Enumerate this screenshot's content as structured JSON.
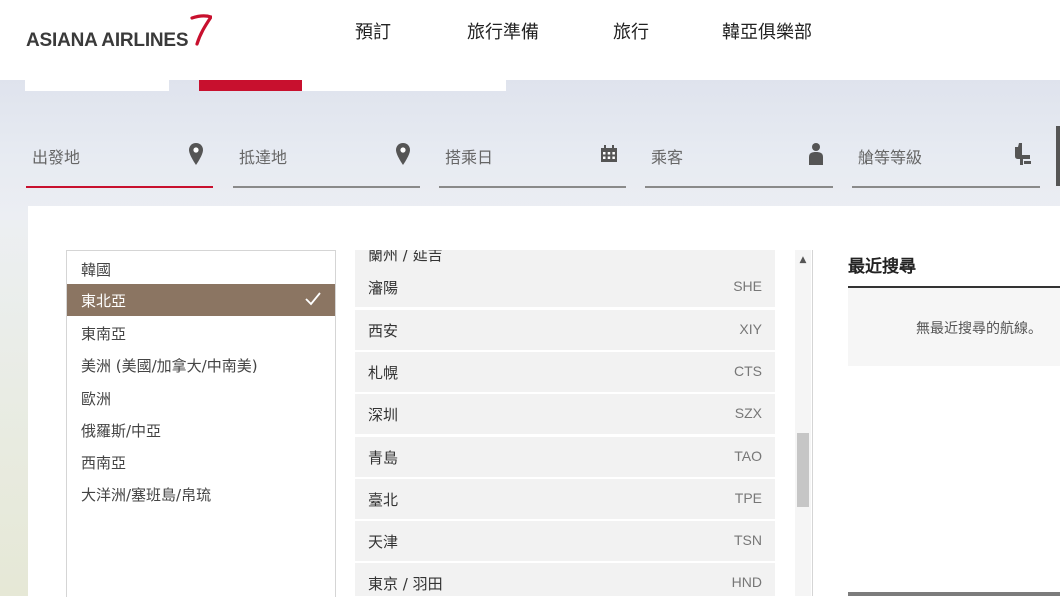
{
  "brand": {
    "name": "ASIANA AIRLINES",
    "accent": "#c8102e"
  },
  "nav": {
    "items": [
      "預訂",
      "旅行準備",
      "旅行",
      "韓亞俱樂部"
    ]
  },
  "search": {
    "fields": [
      {
        "label": "出發地",
        "icon": "map-pin-icon"
      },
      {
        "label": "抵達地",
        "icon": "map-pin-icon"
      },
      {
        "label": "搭乘日",
        "icon": "calendar-icon"
      },
      {
        "label": "乘客",
        "icon": "person-icon"
      },
      {
        "label": "艙等等級",
        "icon": "seat-icon"
      }
    ]
  },
  "regions": {
    "items": [
      "韓國",
      "東北亞",
      "東南亞",
      "美洲 (美國/加拿大/中南美)",
      "歐洲",
      "俄羅斯/中亞",
      "西南亞",
      "大洋洲/塞班島/帛琉"
    ],
    "selected": "東北亞",
    "selected_color": "#8b7562"
  },
  "cities": {
    "partial_top": "蘭州 / 延吉",
    "items": [
      {
        "name": "瀋陽",
        "code": "SHE"
      },
      {
        "name": "西安",
        "code": "XIY"
      },
      {
        "name": "札幌",
        "code": "CTS"
      },
      {
        "name": "深圳",
        "code": "SZX"
      },
      {
        "name": "青島",
        "code": "TAO"
      },
      {
        "name": "臺北",
        "code": "TPE"
      },
      {
        "name": "天津",
        "code": "TSN"
      },
      {
        "name": "東京 / 羽田",
        "code": "HND"
      }
    ]
  },
  "recent": {
    "title": "最近搜尋",
    "empty": "無最近搜尋的航線。"
  }
}
